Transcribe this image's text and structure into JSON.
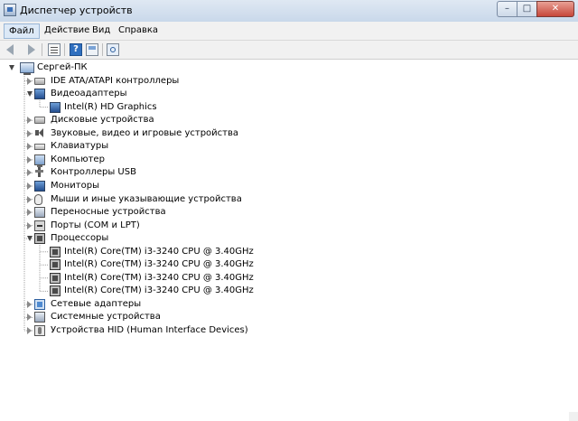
{
  "window": {
    "title": "Диспетчер устройств",
    "controls": {
      "minimize": "–",
      "maximize": "□",
      "close": "✕"
    }
  },
  "menu": {
    "file": "Файл",
    "action": "Действие",
    "view": "Вид",
    "help": "Справка"
  },
  "toolbar": {
    "icons": [
      "back-arrow-icon",
      "forward-arrow-icon",
      "properties-icon",
      "help-icon",
      "update-driver-icon",
      "scan-hardware-icon"
    ],
    "help_glyph": "?"
  },
  "tree": {
    "root": "Сергей-ПК",
    "items": [
      {
        "label": "IDE ATA/ATAPI контроллеры",
        "icon": "disk-controller-icon",
        "expanded": false,
        "children": []
      },
      {
        "label": "Видеоадаптеры",
        "icon": "display-adapter-icon",
        "expanded": true,
        "children": [
          "Intel(R) HD Graphics"
        ]
      },
      {
        "label": "Дисковые устройства",
        "icon": "disk-drive-icon",
        "expanded": false,
        "children": []
      },
      {
        "label": "Звуковые, видео и игровые устройства",
        "icon": "speaker-icon",
        "expanded": false,
        "children": []
      },
      {
        "label": "Клавиатуры",
        "icon": "keyboard-icon",
        "expanded": false,
        "children": []
      },
      {
        "label": "Компьютер",
        "icon": "computer-icon",
        "expanded": false,
        "children": []
      },
      {
        "label": "Контроллеры USB",
        "icon": "usb-icon",
        "expanded": false,
        "children": []
      },
      {
        "label": "Мониторы",
        "icon": "monitor-icon",
        "expanded": false,
        "children": []
      },
      {
        "label": "Мыши и иные указывающие устройства",
        "icon": "mouse-icon",
        "expanded": false,
        "children": []
      },
      {
        "label": "Переносные устройства",
        "icon": "portable-device-icon",
        "expanded": false,
        "children": []
      },
      {
        "label": "Порты (COM и LPT)",
        "icon": "port-icon",
        "expanded": false,
        "children": []
      },
      {
        "label": "Процессоры",
        "icon": "processor-icon",
        "expanded": true,
        "children": [
          "Intel(R) Core(TM) i3-3240 CPU @ 3.40GHz",
          "Intel(R) Core(TM) i3-3240 CPU @ 3.40GHz",
          "Intel(R) Core(TM) i3-3240 CPU @ 3.40GHz",
          "Intel(R) Core(TM) i3-3240 CPU @ 3.40GHz"
        ]
      },
      {
        "label": "Сетевые адаптеры",
        "icon": "network-adapter-icon",
        "expanded": false,
        "children": []
      },
      {
        "label": "Системные устройства",
        "icon": "system-device-icon",
        "expanded": false,
        "children": []
      },
      {
        "label": "Устройства HID (Human Interface Devices)",
        "icon": "hid-icon",
        "expanded": false,
        "children": []
      }
    ]
  }
}
